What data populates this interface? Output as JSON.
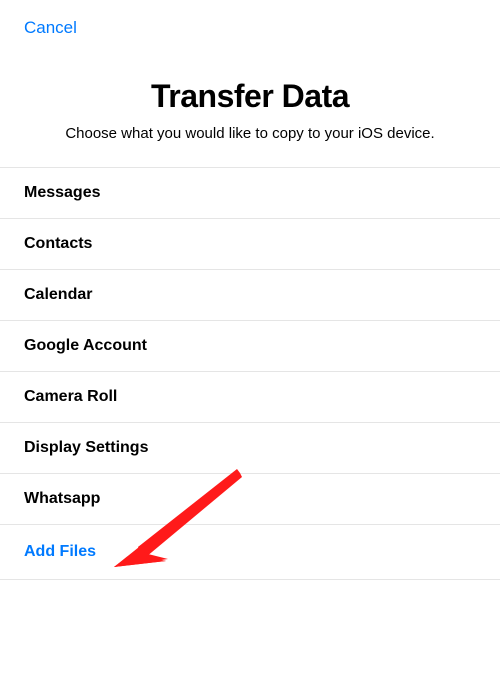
{
  "header": {
    "cancel_label": "Cancel"
  },
  "title_section": {
    "title": "Transfer Data",
    "subtitle": "Choose what you would like to copy to your iOS device."
  },
  "list": {
    "items": [
      {
        "label": "Messages"
      },
      {
        "label": "Contacts"
      },
      {
        "label": "Calendar"
      },
      {
        "label": "Google Account"
      },
      {
        "label": "Camera Roll"
      },
      {
        "label": "Display Settings"
      },
      {
        "label": "Whatsapp"
      }
    ]
  },
  "actions": {
    "add_files_label": "Add Files"
  },
  "annotation": {
    "arrow_target": "whatsapp-item",
    "arrow_color": "#ff1a1a"
  }
}
